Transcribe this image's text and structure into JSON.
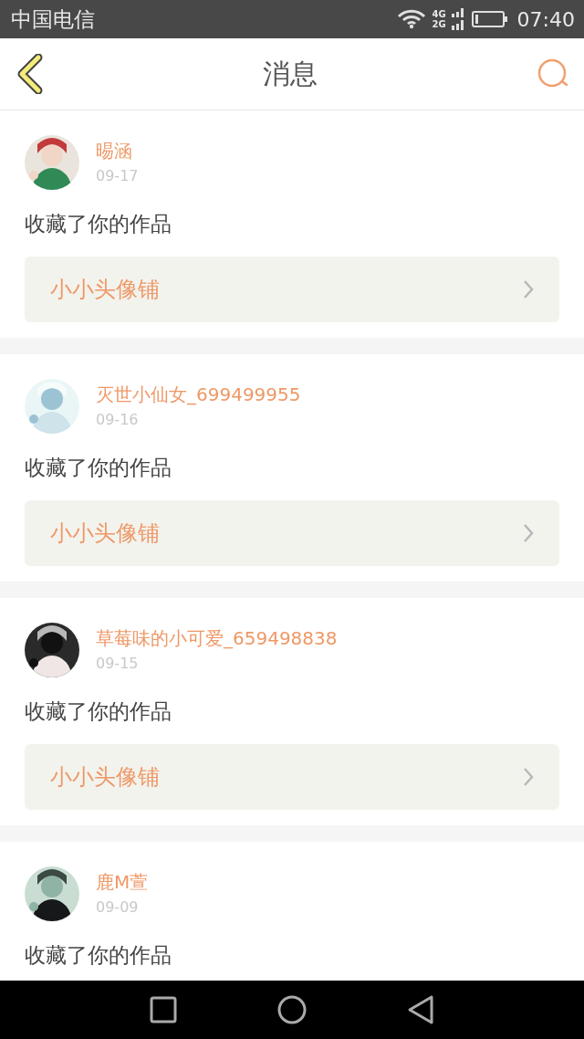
{
  "status_bar": {
    "carrier": "中国电信",
    "network_top": "4G",
    "network_bottom": "2G",
    "time": "07:40"
  },
  "header": {
    "title": "消息"
  },
  "messages": [
    {
      "user": "晹涵",
      "date": "09-17",
      "text": "收藏了你的作品",
      "work": "小小头像铺"
    },
    {
      "user": "灭世小仙女_699499955",
      "date": "09-16",
      "text": "收藏了你的作品",
      "work": "小小头像铺"
    },
    {
      "user": "草莓味的小可爱_659498838",
      "date": "09-15",
      "text": "收藏了你的作品",
      "work": "小小头像铺"
    },
    {
      "user": "鹿M萱",
      "date": "09-09",
      "text": "收藏了你的作品"
    }
  ]
}
